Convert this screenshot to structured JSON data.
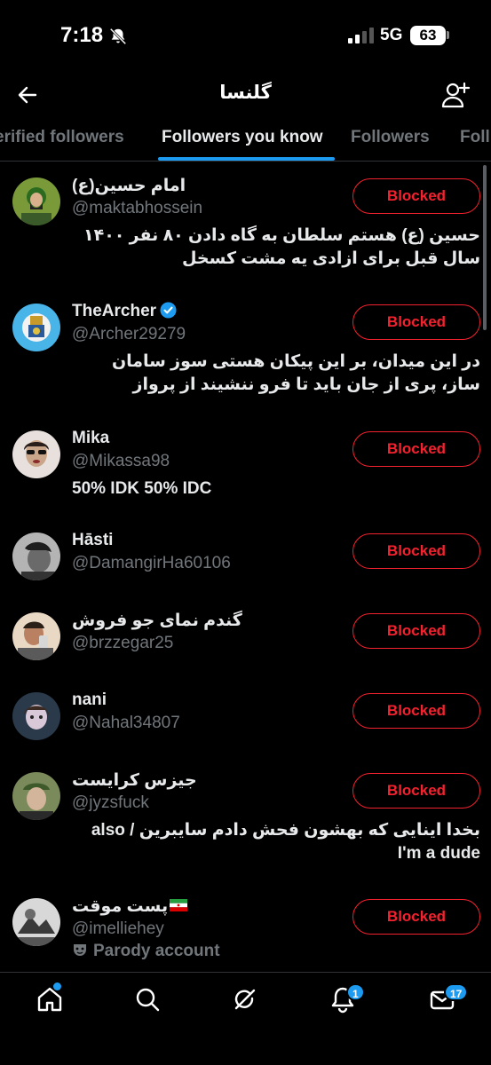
{
  "status_bar": {
    "time": "7:18",
    "network": "5G",
    "battery": "63"
  },
  "header": {
    "title": "گلنسا",
    "back_icon": "arrow-left-icon",
    "add_icon": "add-user-icon"
  },
  "tabs": [
    {
      "label": "erified followers"
    },
    {
      "label": "Followers you know",
      "active": true
    },
    {
      "label": "Followers"
    },
    {
      "label": "Foll"
    }
  ],
  "users": [
    {
      "name": "امام حسین(ع)",
      "handle": "@maktabhossein",
      "bio": "حسین (ع) هستم سلطان به گاه دادن ۸۰ نفر ۱۴۰۰ سال قبل برای ازادی یه مشت کسخل",
      "button": "Blocked"
    },
    {
      "name": "TheArcher",
      "verified": true,
      "handle": "@Archer29279",
      "bio": "در این میدان، بر این پیکان هستی سوز سامان ساز، پری از جان باید تا فرو ننشیند از پرواز",
      "button": "Blocked"
    },
    {
      "name": "Mika",
      "handle": "@Mikassa98",
      "bio": "50% IDK 50% IDC",
      "button": "Blocked"
    },
    {
      "name": "Hāsti",
      "handle": "@DamangirHa60106",
      "button": "Blocked"
    },
    {
      "name": "گندم نمای جو فروش",
      "handle": "@brzzegar25",
      "button": "Blocked"
    },
    {
      "name": "nani",
      "handle": "@Nahal34807",
      "button": "Blocked"
    },
    {
      "name": "جیزس کرایست",
      "handle": "@jyzsfuck",
      "bio_line1": "بخدا اینایی که بهشون فحش دادم سایبرین / also",
      "bio_line2": "I'm a dude",
      "button": "Blocked"
    },
    {
      "name": "پست موقت",
      "handle": "@imelliehey",
      "parody": "Parody account",
      "button": "Blocked"
    }
  ],
  "bottom_nav": {
    "items": [
      "home-icon",
      "search-icon",
      "grok-icon",
      "notifications-icon",
      "messages-icon"
    ],
    "notifications_badge": "1",
    "messages_badge": "17"
  },
  "colors": {
    "background": "#000000",
    "accent": "#1d9bf0",
    "blocked": "#f4212e",
    "secondary_text": "#71767b"
  }
}
